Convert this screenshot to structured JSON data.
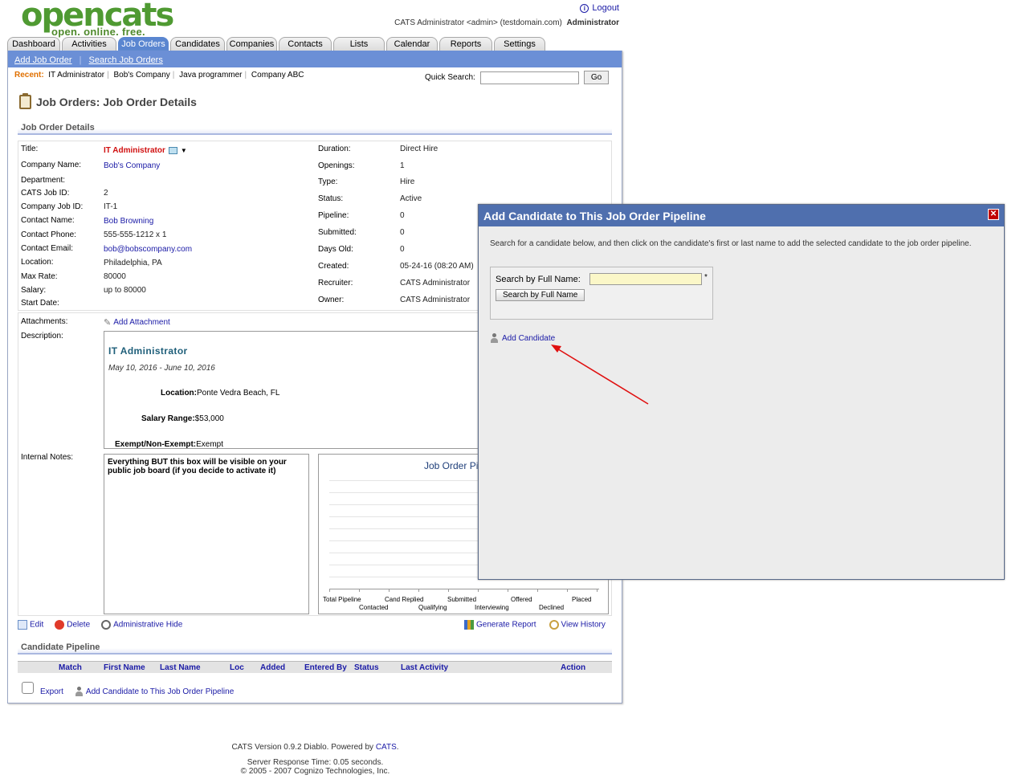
{
  "logo": {
    "word_open": "open",
    "word_cats": "cats",
    "tagline": "open. online. free."
  },
  "header": {
    "logout": "Logout",
    "user_text": "CATS Administrator <admin> (testdomain.com)",
    "role": "Administrator"
  },
  "tabs": [
    {
      "label": "Dashboard"
    },
    {
      "label": "Activities"
    },
    {
      "label": "Job Orders"
    },
    {
      "label": "Candidates"
    },
    {
      "label": "Companies"
    },
    {
      "label": "Contacts"
    },
    {
      "label": "Lists"
    },
    {
      "label": "Calendar"
    },
    {
      "label": "Reports"
    },
    {
      "label": "Settings"
    }
  ],
  "subnav": {
    "add": "Add Job Order",
    "search": "Search Job Orders"
  },
  "recent": {
    "label": "Recent:",
    "items": [
      "IT Administrator",
      "Bob's Company",
      "Java programmer",
      "Company ABC"
    ]
  },
  "quick_search": {
    "label": "Quick Search:",
    "go": "Go",
    "value": ""
  },
  "page_title": "Job Orders: Job Order Details",
  "details": {
    "section": "Job Order Details",
    "title_label": "Title:",
    "title_value": "IT Administrator",
    "company_label": "Company Name:",
    "company_value": "Bob's Company",
    "department_label": "Department:",
    "department_value": "",
    "jobid_label": "CATS Job ID:",
    "jobid_value": "2",
    "companyjobid_label": "Company Job ID:",
    "companyjobid_value": "IT-1",
    "contact_label": "Contact Name:",
    "contact_value": "Bob Browning",
    "phone_label": "Contact Phone:",
    "phone_value": "555-555-1212 x 1",
    "email_label": "Contact Email:",
    "email_value": "bob@bobscompany.com",
    "location_label": "Location:",
    "location_value": "Philadelphia, PA",
    "maxrate_label": "Max Rate:",
    "maxrate_value": "80000",
    "salary_label": "Salary:",
    "salary_value": "up to 80000",
    "startdate_label": "Start Date:",
    "startdate_value": "",
    "duration_label": "Duration:",
    "duration_value": "Direct Hire",
    "openings_label": "Openings:",
    "openings_value": "1",
    "type_label": "Type:",
    "type_value": "Hire",
    "status_label": "Status:",
    "status_value": "Active",
    "pipeline_label": "Pipeline:",
    "pipeline_value": "0",
    "submitted_label": "Submitted:",
    "submitted_value": "0",
    "daysold_label": "Days Old:",
    "daysold_value": "0",
    "created_label": "Created:",
    "created_value": "05-24-16 (08:20 AM)",
    "recruiter_label": "Recruiter:",
    "recruiter_value": "CATS Administrator",
    "owner_label": "Owner:",
    "owner_value": "CATS Administrator"
  },
  "attachments": {
    "label": "Attachments:",
    "add": "Add Attachment"
  },
  "description": {
    "label": "Description:",
    "heading": "IT Administrator",
    "dates": "May 10, 2016 - June 10, 2016",
    "location_label": "Location:",
    "location_value": "Ponte Vedra Beach, FL",
    "salary_label": "Salary Range:",
    "salary_value": "$53,000",
    "exempt_label": "Exempt/Non-Exempt:",
    "exempt_value": "Exempt"
  },
  "notes": {
    "label": "Internal Notes:",
    "text": "Everything BUT this box will be visible on your public job board (if you decide to activate it)"
  },
  "chart": {
    "title": "Job Order Pi",
    "labels_top": [
      "Total Pipeline",
      "Cand Replied",
      "Submitted",
      "Offered",
      "Placed"
    ],
    "labels_bottom": [
      "Contacted",
      "Qualifying",
      "Interviewing",
      "Declined"
    ]
  },
  "actions": {
    "edit": "Edit",
    "delete": "Delete",
    "hide": "Administrative Hide",
    "report": "Generate Report",
    "history": "View History"
  },
  "pipeline": {
    "section": "Candidate Pipeline",
    "columns": [
      "Match",
      "First Name",
      "Last Name",
      "Loc",
      "Added",
      "Entered By",
      "Status",
      "Last Activity",
      "Action"
    ],
    "export": "Export",
    "add": "Add Candidate to This Job Order Pipeline"
  },
  "footer": {
    "version_prefix": "CATS Version 0.9.2 Diablo. Powered by ",
    "version_link": "CATS",
    "version_suffix": ".",
    "response": "Server Response Time: 0.05 seconds.",
    "copyright": "© 2005 - 2007 Cognizo Technologies, Inc."
  },
  "modal": {
    "title": "Add Candidate to This Job Order Pipeline",
    "close": "✕",
    "instructions": "Search for a candidate below, and then click on the candidate's first or last name to add the selected candidate to the job order pipeline.",
    "search_label": "Search by Full Name:",
    "search_value": "",
    "required": "*",
    "search_button": "Search by Full Name",
    "add_candidate": "Add Candidate"
  },
  "colors": {
    "accent": "#4f6fae",
    "subnav": "#6b8fd6",
    "annotation_arrow": "#e01010",
    "title_red": "#d01010"
  }
}
